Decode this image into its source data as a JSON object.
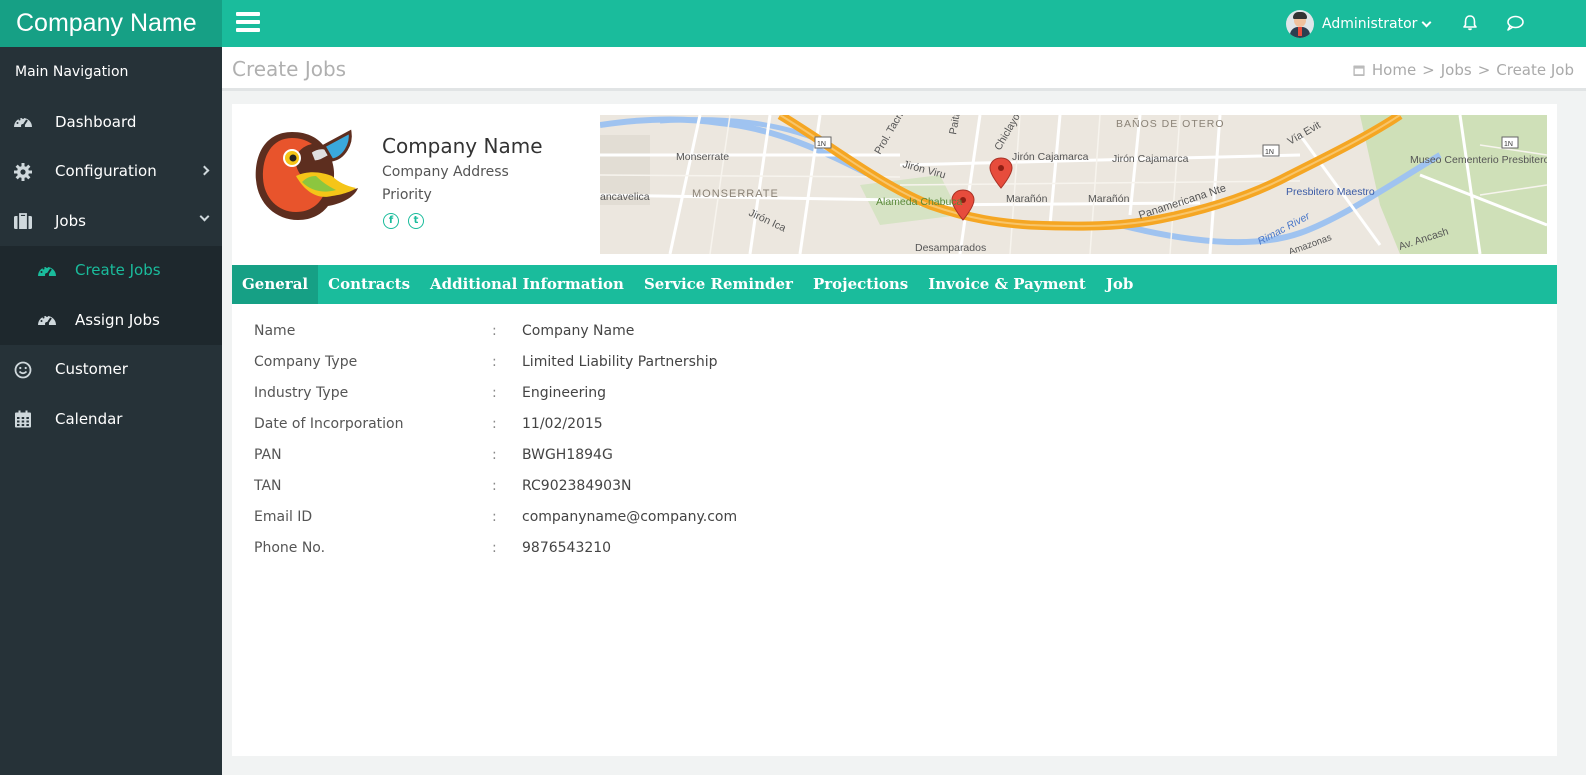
{
  "brand": "Company Name",
  "header": {
    "user_name": "Administrator"
  },
  "sidebar": {
    "heading": "Main Navigation",
    "items": [
      {
        "label": "Dashboard"
      },
      {
        "label": "Configuration"
      },
      {
        "label": "Jobs"
      },
      {
        "label": "Create Jobs"
      },
      {
        "label": "Assign Jobs"
      },
      {
        "label": "Customer"
      },
      {
        "label": "Calendar"
      }
    ]
  },
  "page": {
    "title": "Create Jobs",
    "breadcrumb": [
      "Home",
      ">",
      "Jobs",
      ">",
      "Create Job"
    ]
  },
  "company": {
    "name": "Company Name",
    "address": "Company Address",
    "priority": "Priority"
  },
  "map": {
    "labels": [
      "Monserrate",
      "MONSERRATE",
      "Alameda Chabuca",
      "Desamparados",
      "Jirón Cajamarca",
      "Jirón Cajamarca",
      "Marañón",
      "Marañón",
      "Panamericana Nte",
      "Vía Evit",
      "Presbitero Maestro",
      "Museo Cementerio Presbitero Maestro",
      "Rimac River",
      "Amazonas",
      "Av. Ancash",
      "BAÑOS DE OTERO",
      "Jirón Viru",
      "Jirón Ica",
      "Prol. Tacna",
      "Paita",
      "Chiclayo",
      "ancavelica",
      "1N",
      "1N",
      "1N"
    ]
  },
  "tabs": [
    "General",
    "Contracts",
    "Additional Information",
    "Service Reminder",
    "Projections",
    "Invoice & Payment",
    "Job"
  ],
  "details": [
    {
      "key": "Name",
      "sep": ":",
      "value": "Company Name"
    },
    {
      "key": "Company Type",
      "sep": ":",
      "value": "Limited Liability Partnership"
    },
    {
      "key": "Industry Type",
      "sep": ":",
      "value": "Engineering"
    },
    {
      "key": "Date of Incorporation",
      "sep": ":",
      "value": "11/02/2015"
    },
    {
      "key": "PAN",
      "sep": ":",
      "value": "BWGH1894G"
    },
    {
      "key": "TAN",
      "sep": ":",
      "value": "RC902384903N"
    },
    {
      "key": "Email ID",
      "sep": ":",
      "value": "companyname@company.com"
    },
    {
      "key": "Phone No.",
      "sep": ":",
      "value": "9876543210"
    }
  ],
  "colors": {
    "accent": "#1abc9c",
    "accent_dark": "#16a085",
    "sidebar": "#263238"
  }
}
